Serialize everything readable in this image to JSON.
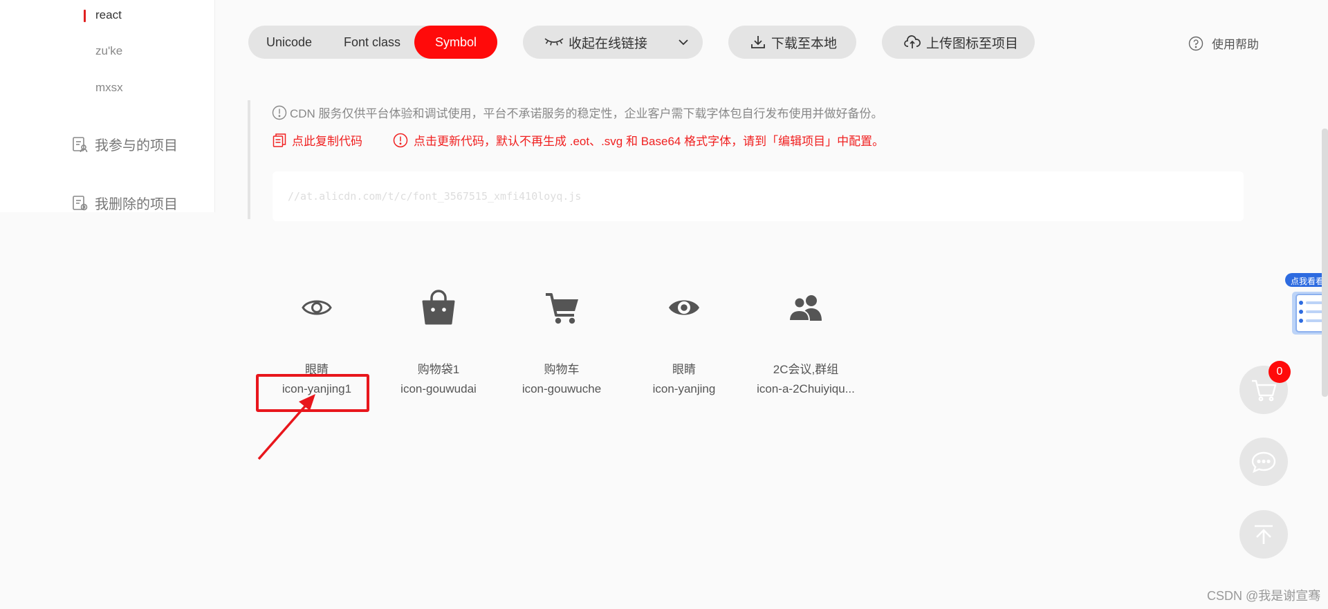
{
  "sidebar": {
    "projects": [
      "react",
      "zu'ke",
      "mxsx"
    ],
    "participated": "我参与的项目",
    "deleted": "我删除的项目"
  },
  "toolbar": {
    "tabs": [
      "Unicode",
      "Font class",
      "Symbol"
    ],
    "active_tab": "Symbol",
    "collapse_link": "收起在线链接",
    "download": "下载至本地",
    "upload": "上传图标至项目",
    "help": "使用帮助"
  },
  "notice": {
    "cdn_warning": "CDN 服务仅供平台体验和调试使用，平台不承诺服务的稳定性，企业客户需下载字体包自行发布使用并做好备份。",
    "copy_code": "点此复制代码",
    "update_code": "点击更新代码，默认不再生成 .eot、.svg 和 Base64 格式字体，请到「编辑项目」中配置。"
  },
  "cdn_url": "//at.alicdn.com/t/c/font_3567515_xmfi410loyq.js",
  "icons": [
    {
      "name": "眼睛",
      "code": "icon-yanjing1",
      "glyph": "eye-outline-icon"
    },
    {
      "name": "购物袋1",
      "code": "icon-gouwudai",
      "glyph": "shopping-bag-icon"
    },
    {
      "name": "购物车",
      "code": "icon-gouwuche",
      "glyph": "shopping-cart-icon"
    },
    {
      "name": "眼睛",
      "code": "icon-yanjing",
      "glyph": "eye-filled-icon"
    },
    {
      "name": "2C会议,群组",
      "code": "icon-a-2Chuiyiqu...",
      "glyph": "group-users-icon"
    }
  ],
  "cart_count": "0",
  "promo_label": "点我看看",
  "watermark": "CSDN @我是谢宣骞",
  "colors": {
    "accent": "#ff0a0a",
    "annotation": "#e8161c",
    "pill_bg": "#e4e4e4"
  }
}
